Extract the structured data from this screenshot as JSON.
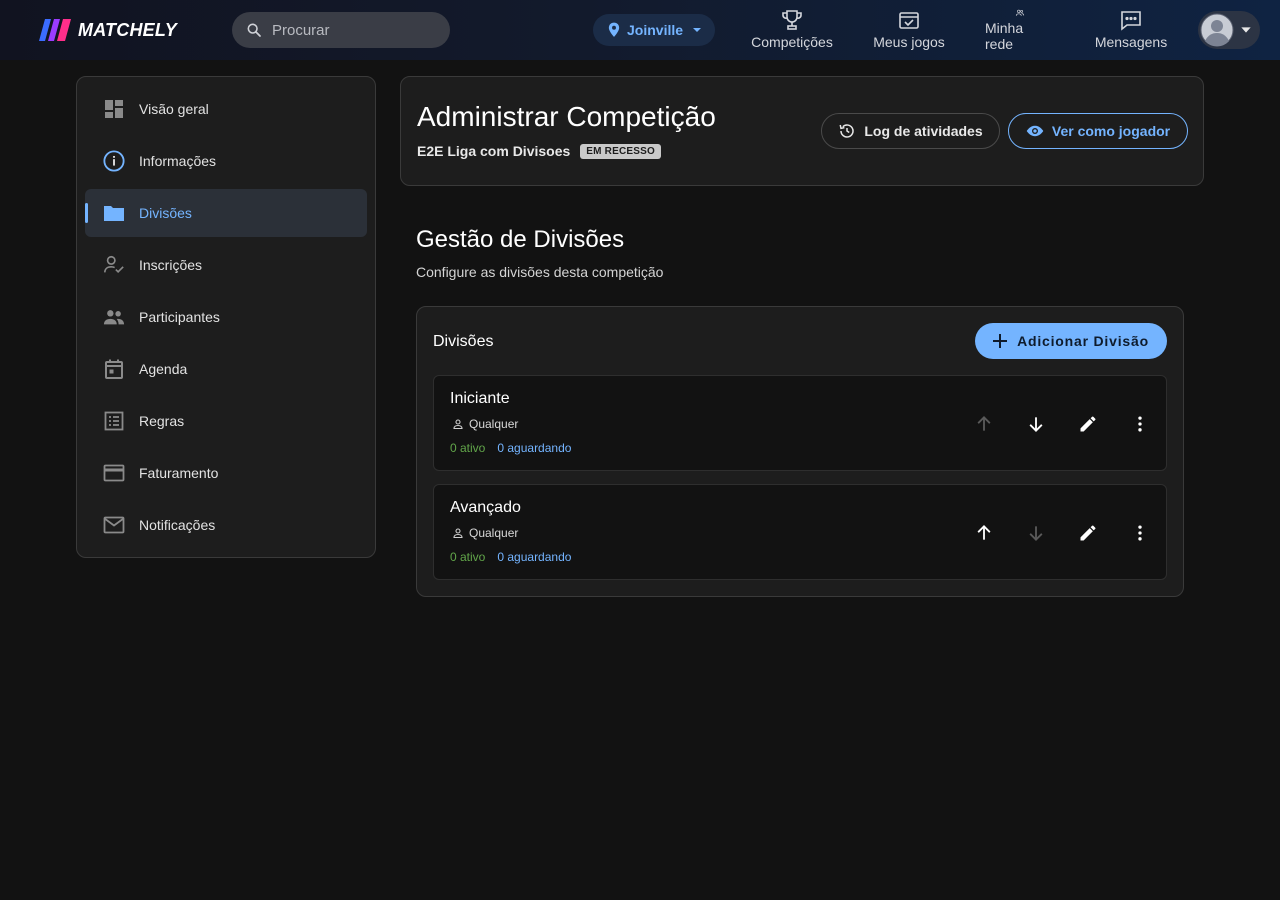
{
  "header": {
    "logo_text": "MATCHELY",
    "search_placeholder": "Procurar",
    "location": "Joinville",
    "nav": [
      {
        "label": "Competições",
        "icon": "trophy-icon"
      },
      {
        "label": "Meus jogos",
        "icon": "calendar-check-icon"
      },
      {
        "label": "Minha rede",
        "icon": "people-icon"
      },
      {
        "label": "Mensagens",
        "icon": "message-icon"
      }
    ]
  },
  "sidebar": {
    "items": [
      {
        "label": "Visão geral",
        "icon": "dashboard-icon"
      },
      {
        "label": "Informações",
        "icon": "info-icon"
      },
      {
        "label": "Divisões",
        "icon": "folder-icon",
        "active": true
      },
      {
        "label": "Inscrições",
        "icon": "person-check-icon"
      },
      {
        "label": "Participantes",
        "icon": "group-icon"
      },
      {
        "label": "Agenda",
        "icon": "calendar-icon"
      },
      {
        "label": "Regras",
        "icon": "list-icon"
      },
      {
        "label": "Faturamento",
        "icon": "credit-card-icon"
      },
      {
        "label": "Notificações",
        "icon": "mail-icon"
      }
    ]
  },
  "admin": {
    "title": "Administrar Competição",
    "competition_name": "E2E Liga com Divisoes",
    "status_badge": "EM RECESSO",
    "log_button": "Log de atividades",
    "view_button": "Ver como jogador"
  },
  "section": {
    "title": "Gestão de Divisões",
    "subtitle": "Configure as divisões desta competição"
  },
  "panel": {
    "title": "Divisões",
    "add_button": "Adicionar Divisão",
    "divisions": [
      {
        "name": "Iniciante",
        "level": "Qualquer",
        "active": "0 ativo",
        "waiting": "0 aguardando",
        "can_move_up": false,
        "can_move_down": true
      },
      {
        "name": "Avançado",
        "level": "Qualquer",
        "active": "0 ativo",
        "waiting": "0 aguardando",
        "can_move_up": true,
        "can_move_down": false
      }
    ]
  },
  "colors": {
    "accent": "#74b4ff",
    "active_green": "#62a64a",
    "background": "#121212",
    "card": "#1d1d1d"
  }
}
